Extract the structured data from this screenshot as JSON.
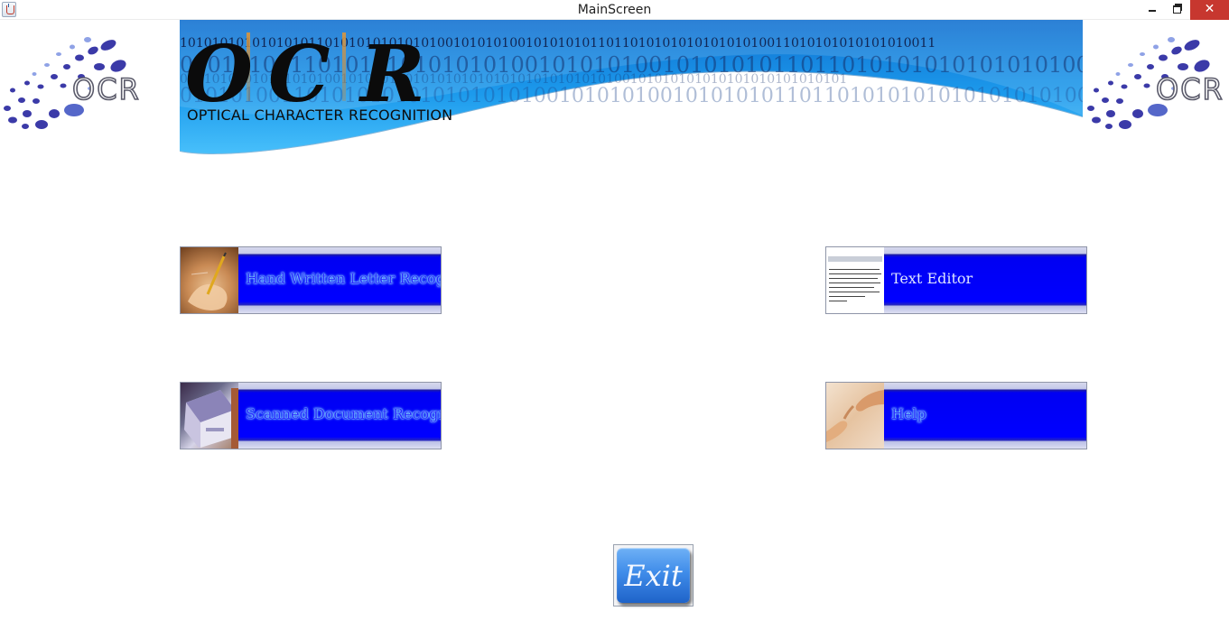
{
  "window": {
    "title": "MainScreen",
    "minimize_glyph": "",
    "maximize_glyph": "",
    "close_glyph": "✕"
  },
  "logo": {
    "text": "OCR"
  },
  "banner": {
    "letters": [
      "O",
      "C",
      "R"
    ],
    "subtitle": "OPTICAL CHARACTER RECOGNITION",
    "binary_rows": [
      "1010101010101010110101010101010100101010100101010101101101010101010101010011010101010101010011",
      "010101001101010101010101001010101001010101011011010101010101010100",
      "01010101010101010100101010100101010101010101010101010100101010101010101010101010101",
      "010101001101010101010101010100101010100101010101101101010101010101010100110"
    ]
  },
  "buttons": {
    "hand": {
      "label": "Hand Written Letter Recognition",
      "thumbnail": "hand-writing-image"
    },
    "text": {
      "label": "Text Editor",
      "thumbnail": "text-document-image"
    },
    "scan": {
      "label": "Scanned Document Recognition",
      "thumbnail": "scanner-image"
    },
    "help": {
      "label": "Help",
      "thumbnail": "helping-hands-image"
    },
    "exit": {
      "label": "Exit"
    }
  },
  "colors": {
    "banner_blue": "#1ea0ee",
    "tile_blue": "#0000ff",
    "close_red": "#c7372f",
    "exit_blue": "#3f8ce9"
  }
}
